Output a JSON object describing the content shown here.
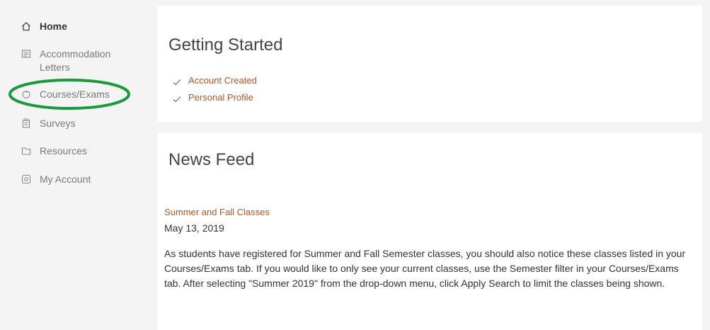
{
  "sidebar": {
    "items": [
      {
        "label": "Home",
        "icon": "home-icon"
      },
      {
        "label": "Accommodation Letters",
        "icon": "letter-icon"
      },
      {
        "label": "Courses/Exams",
        "icon": "courses-icon"
      },
      {
        "label": "Surveys",
        "icon": "clipboard-icon"
      },
      {
        "label": "Resources",
        "icon": "folder-icon"
      },
      {
        "label": "My Account",
        "icon": "gear-icon"
      }
    ],
    "active_item": "Home",
    "highlight_color": "#1a9a3a"
  },
  "getting_started": {
    "title": "Getting Started",
    "items": [
      {
        "label": "Account Created",
        "checked": true
      },
      {
        "label": "Personal Profile",
        "checked": true
      }
    ]
  },
  "news_feed": {
    "title": "News Feed",
    "post": {
      "title": "Summer and Fall Classes",
      "date": "May 13, 2019",
      "body": "As students have registered for Summer and Fall Semester classes, you should also notice these classes listed in your Courses/Exams tab. If you would like to only see your current classes, use the Semester filter in your Courses/Exams tab. After selecting \"Summer 2019\" from the drop-down menu, click Apply Search to limit the classes being shown."
    }
  },
  "colors": {
    "accent": "#c0521a",
    "sidebar_bg": "#f4f4f4",
    "card_bg": "#ffffff",
    "muted_text": "#7a7a7a"
  }
}
